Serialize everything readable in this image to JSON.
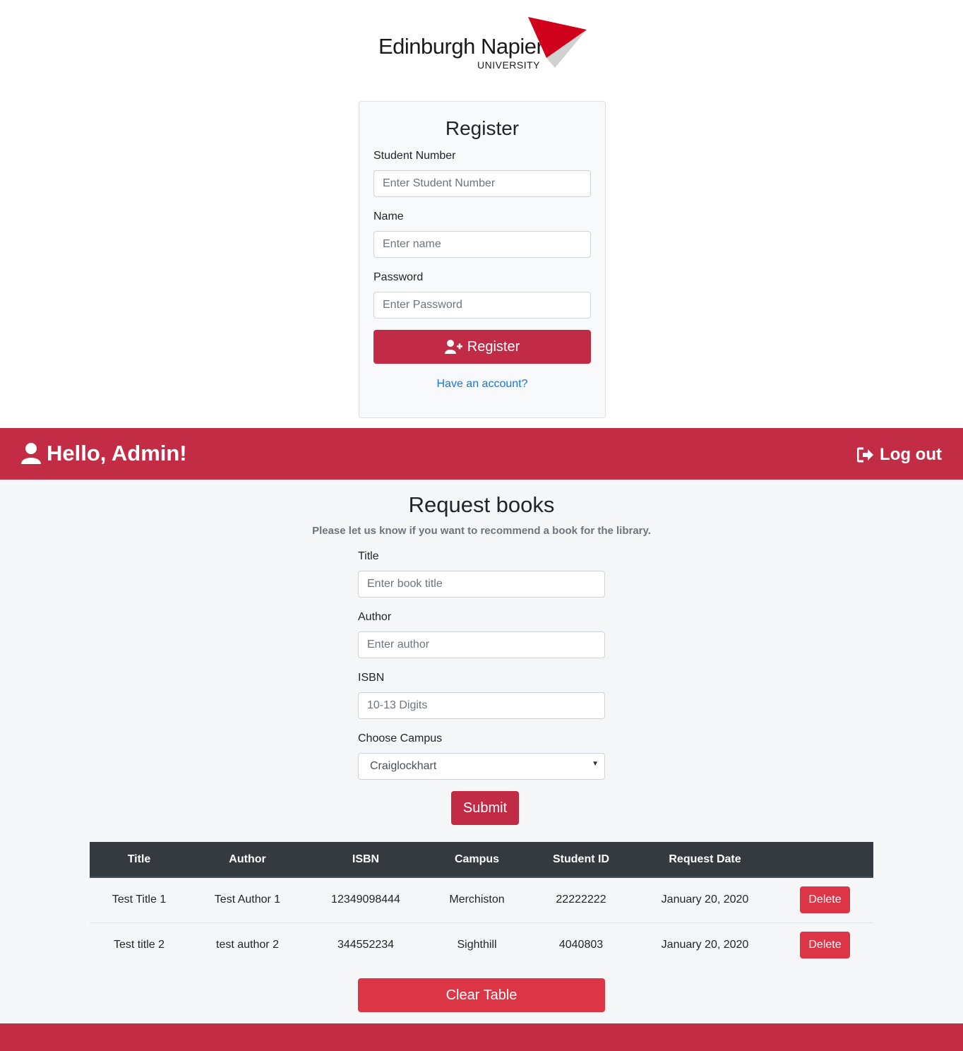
{
  "logo": {
    "name": "Edinburgh Napier",
    "sub": "UNIVERSITY",
    "accent_color": "#d0021b"
  },
  "register": {
    "title": "Register",
    "student_number_label": "Student Number",
    "student_number_placeholder": "Enter Student Number",
    "name_label": "Name",
    "name_placeholder": "Enter name",
    "password_label": "Password",
    "password_placeholder": "Enter Password",
    "button_label": "Register",
    "button_icon": "user-plus-icon",
    "have_account_link": "Have an account?"
  },
  "navbar": {
    "greeting": "Hello, Admin!",
    "greeting_icon": "user-icon",
    "logout_label": "Log out",
    "logout_icon": "sign-out-icon",
    "color": "#c22c45"
  },
  "request": {
    "title": "Request books",
    "subtitle": "Please let us know if you want to recommend a book for the library.",
    "title_label": "Title",
    "title_placeholder": "Enter book title",
    "author_label": "Author",
    "author_placeholder": "Enter author",
    "isbn_label": "ISBN",
    "isbn_placeholder": "10-13 Digits",
    "campus_label": "Choose Campus",
    "campus_selected": "Craiglockhart",
    "submit_label": "Submit"
  },
  "table": {
    "headers": [
      "Title",
      "Author",
      "ISBN",
      "Campus",
      "Student ID",
      "Request Date",
      ""
    ],
    "rows": [
      {
        "title": "Test Title 1",
        "author": "Test Author 1",
        "isbn": "12349098444",
        "campus": "Merchiston",
        "student_id": "22222222",
        "date": "January 20, 2020",
        "action": "Delete"
      },
      {
        "title": "Test title 2",
        "author": "test author 2",
        "isbn": "344552234",
        "campus": "Sighthill",
        "student_id": "4040803",
        "date": "January 20, 2020",
        "action": "Delete"
      }
    ],
    "clear_label": "Clear Table"
  }
}
